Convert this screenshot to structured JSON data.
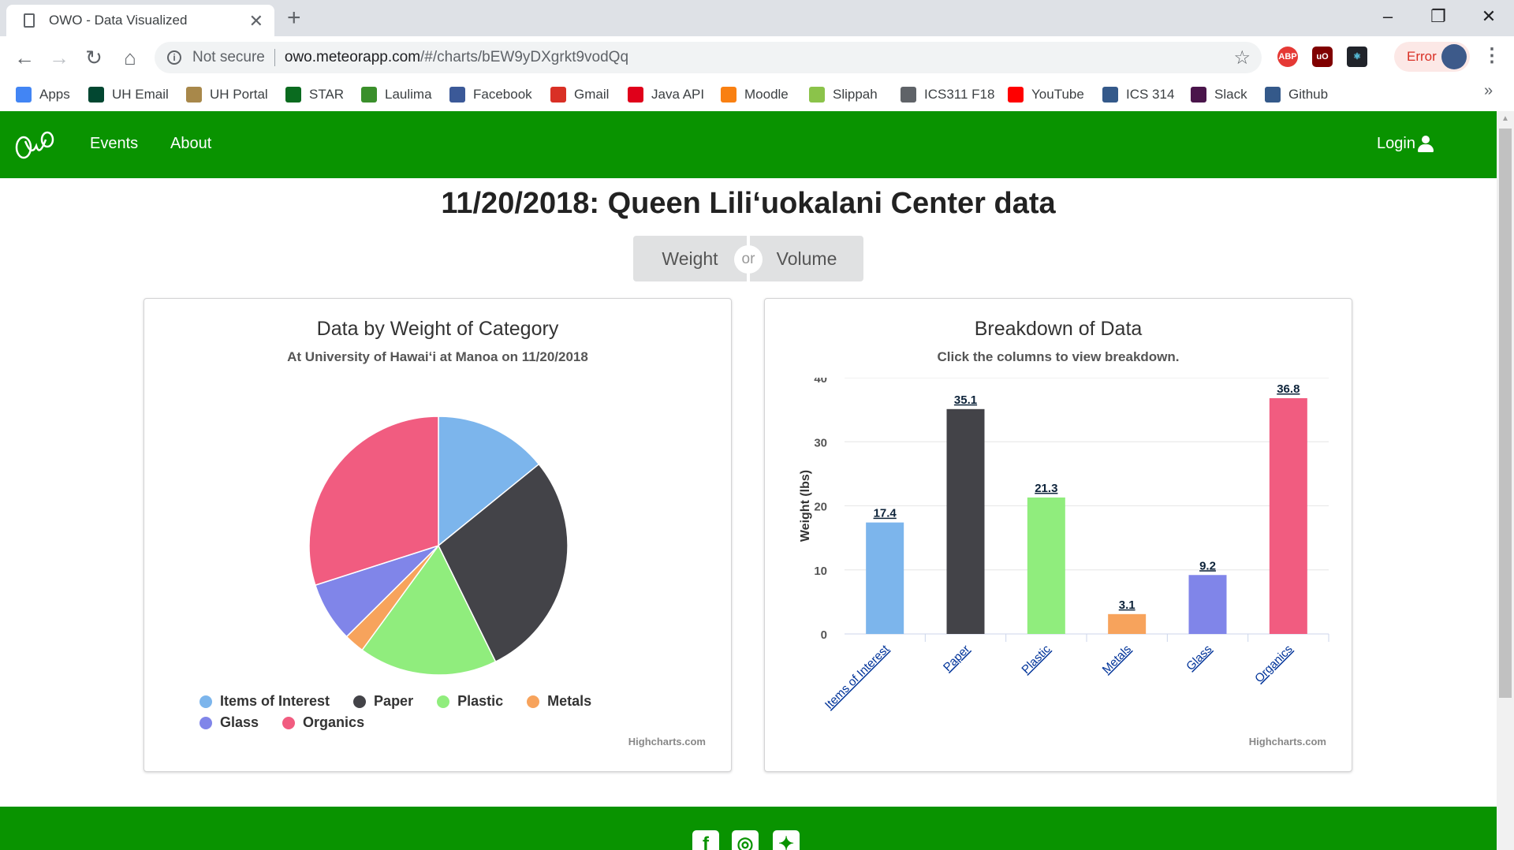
{
  "browser": {
    "tab_title": "OWO - Data Visualized",
    "security_label": "Not secure",
    "url_host": "owo.meteorapp.com",
    "url_path": "/#/charts/bEW9yDXgrkt9vodQq",
    "error_label": "Error",
    "bookmarks": [
      {
        "label": "Apps",
        "icon": "apps-grid-icon",
        "color": "#4285f4"
      },
      {
        "label": "UH Email",
        "icon": "uh-icon",
        "color": "#024731"
      },
      {
        "label": "UH Portal",
        "icon": "uh-portal-icon",
        "color": "#a8884a"
      },
      {
        "label": "STAR",
        "icon": "star-diamond-icon",
        "color": "#0a6b1f"
      },
      {
        "label": "Laulima",
        "icon": "leaf-icon",
        "color": "#3a8f2b"
      },
      {
        "label": "Facebook",
        "icon": "facebook-icon",
        "color": "#3b5998"
      },
      {
        "label": "Gmail",
        "icon": "gmail-icon",
        "color": "#d93025"
      },
      {
        "label": "Java API",
        "icon": "oracle-icon",
        "color": "#e0001a"
      },
      {
        "label": "Moodle",
        "icon": "moodle-icon",
        "color": "#f98012"
      },
      {
        "label": "Slippah",
        "icon": "slippah-icon",
        "color": "#8bc34a"
      },
      {
        "label": "ICS311 F18",
        "icon": "document-icon",
        "color": "#5f6368"
      },
      {
        "label": "YouTube",
        "icon": "youtube-icon",
        "color": "#ff0000"
      },
      {
        "label": "ICS 314",
        "icon": "ics314-icon",
        "color": "#34598a"
      },
      {
        "label": "Slack",
        "icon": "slack-icon",
        "color": "#4a154b"
      },
      {
        "label": "Github",
        "icon": "github-icon",
        "color": "#34598a"
      }
    ]
  },
  "nav": {
    "logo_text": "OWO",
    "events_label": "Events",
    "about_label": "About",
    "login_label": "Login"
  },
  "page": {
    "title": "11/20/2018: Queen Liliʻuokalani Center data",
    "toggle_weight": "Weight",
    "toggle_or": "or",
    "toggle_volume": "Volume"
  },
  "colors": {
    "brand_green": "#099300",
    "items_of_interest": "#7cb5ec",
    "paper": "#434348",
    "plastic": "#90ed7d",
    "metals": "#f7a35c",
    "glass": "#8085e9",
    "organics": "#f15c80"
  },
  "chart_data": [
    {
      "type": "pie",
      "title": "Data by Weight of Category",
      "subtitle": "At University of Hawaiʻi at Manoa on 11/20/2018",
      "categories": [
        "Items of Interest",
        "Paper",
        "Plastic",
        "Metals",
        "Glass",
        "Organics"
      ],
      "values": [
        17.4,
        35.1,
        21.3,
        3.1,
        9.2,
        36.8
      ],
      "colors": [
        "#7cb5ec",
        "#434348",
        "#90ed7d",
        "#f7a35c",
        "#8085e9",
        "#f15c80"
      ],
      "legend": "bottom",
      "credits": "Highcharts.com"
    },
    {
      "type": "bar",
      "title": "Breakdown of Data",
      "subtitle": "Click the columns to view breakdown.",
      "categories": [
        "Items of Interest",
        "Paper",
        "Plastic",
        "Metals",
        "Glass",
        "Organics"
      ],
      "values": [
        17.4,
        35.1,
        21.3,
        3.1,
        9.2,
        36.8
      ],
      "colors": [
        "#7cb5ec",
        "#434348",
        "#90ed7d",
        "#f7a35c",
        "#8085e9",
        "#f15c80"
      ],
      "xlabel": "",
      "ylabel": "Weight (lbs)",
      "ylim": [
        0,
        40
      ],
      "yticks": [
        0,
        10,
        20,
        30,
        40
      ],
      "grid": true,
      "credits": "Highcharts.com"
    }
  ]
}
